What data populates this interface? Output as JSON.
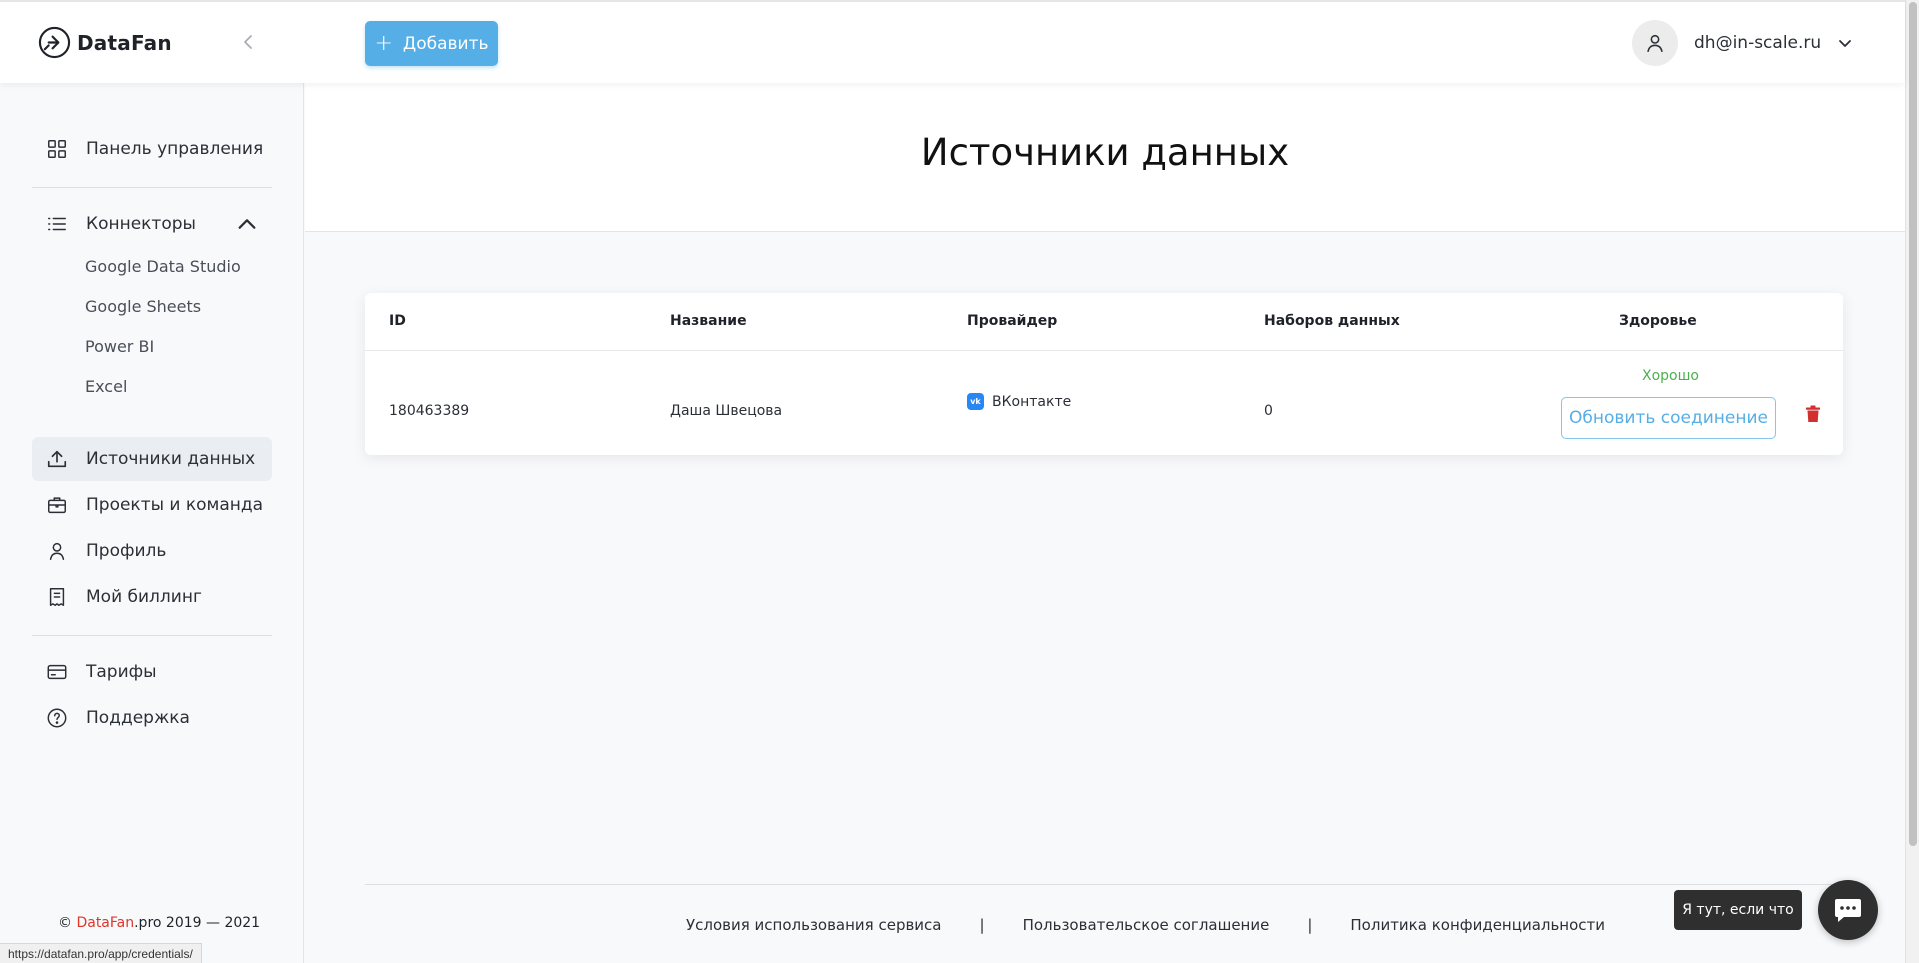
{
  "app": {
    "logo_text": "DataFan"
  },
  "header": {
    "add_label": "Добавить",
    "user_email": "dh@in-scale.ru"
  },
  "sidebar": {
    "dashboard": "Панель управления",
    "connectors": "Коннекторы",
    "connector_items": [
      "Google Data Studio",
      "Google Sheets",
      "Power BI",
      "Excel"
    ],
    "data_sources": "Источники данных",
    "projects": "Проекты и команда",
    "profile": "Профиль",
    "billing": "Мой биллинг",
    "tariffs": "Тарифы",
    "support": "Поддержка"
  },
  "footer_sidebar": {
    "prefix": "© ",
    "brand": "DataFan",
    "suffix": ".pro 2019 — 2021"
  },
  "page": {
    "title": "Источники данных"
  },
  "table": {
    "columns": [
      "ID",
      "Название",
      "Провайдер",
      "Наборов данных",
      "Здоровье"
    ],
    "rows": [
      {
        "id": "180463389",
        "name": "Даша Швецова",
        "provider": "ВКонтакте",
        "datasets": "0",
        "health": "Хорошо",
        "refresh_label": "Обновить соединение"
      }
    ]
  },
  "footer": {
    "links": [
      "Условия использования сервиса",
      "Пользовательское соглашение",
      "Политика конфиденциальности"
    ],
    "separator": "|"
  },
  "chat": {
    "tooltip": "Я тут, если что"
  },
  "status_url": "https://datafan.pro/app/credentials/",
  "colors": {
    "accent": "#56aee6",
    "brand_red": "#e0352b",
    "health_good": "#4caf50",
    "danger": "#d32f2f",
    "vk": "#2787f5"
  },
  "icons": {
    "dashboard": "grid-icon",
    "connectors": "list-icon",
    "data_sources": "upload-icon",
    "projects": "briefcase-icon",
    "profile": "user-icon",
    "billing": "receipt-icon",
    "tariffs": "credit-card-icon",
    "support": "help-circle-icon"
  }
}
